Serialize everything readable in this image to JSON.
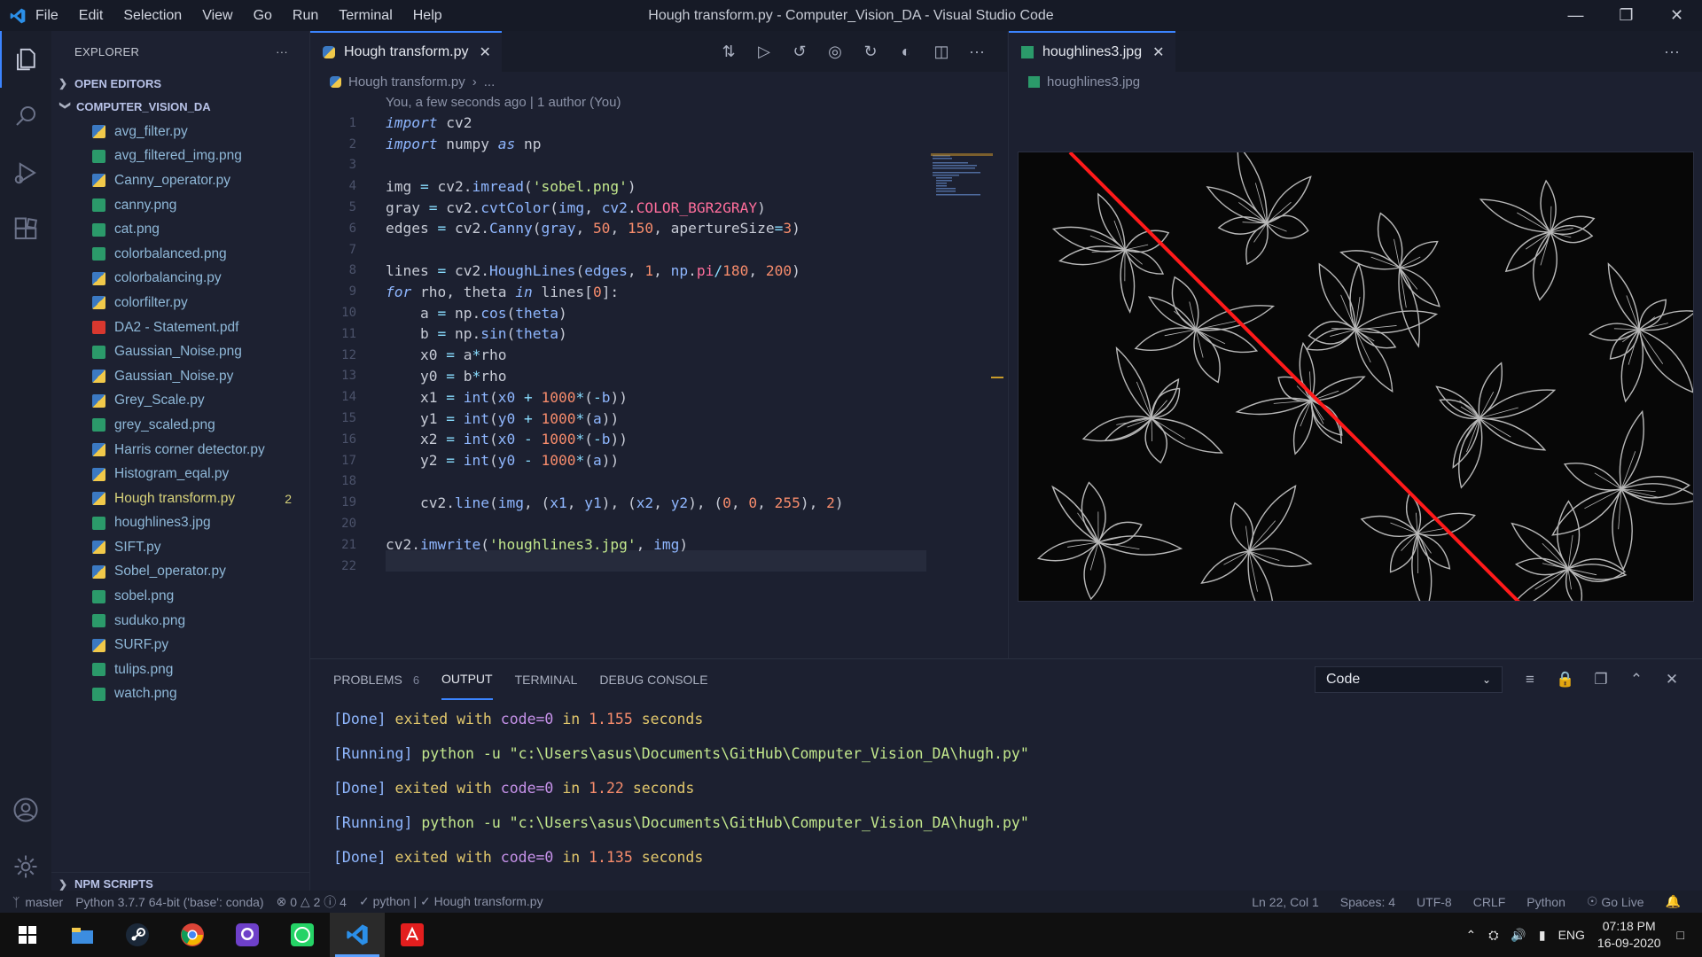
{
  "titlebar": {
    "menu": [
      "File",
      "Edit",
      "Selection",
      "View",
      "Go",
      "Run",
      "Terminal",
      "Help"
    ],
    "title": "Hough transform.py - Computer_Vision_DA - Visual Studio Code"
  },
  "sidebar": {
    "title": "EXPLORER",
    "open_editors": "OPEN EDITORS",
    "folder": "COMPUTER_VISION_DA",
    "npm": "NPM SCRIPTS",
    "files": [
      {
        "name": "avg_filter.py",
        "type": "py"
      },
      {
        "name": "avg_filtered_img.png",
        "type": "img"
      },
      {
        "name": "Canny_operator.py",
        "type": "py"
      },
      {
        "name": "canny.png",
        "type": "img"
      },
      {
        "name": "cat.png",
        "type": "img"
      },
      {
        "name": "colorbalanced.png",
        "type": "img"
      },
      {
        "name": "colorbalancing.py",
        "type": "py"
      },
      {
        "name": "colorfilter.py",
        "type": "py"
      },
      {
        "name": "DA2 - Statement.pdf",
        "type": "pdf"
      },
      {
        "name": "Gaussian_Noise.png",
        "type": "img"
      },
      {
        "name": "Gaussian_Noise.py",
        "type": "py"
      },
      {
        "name": "Grey_Scale.py",
        "type": "py"
      },
      {
        "name": "grey_scaled.png",
        "type": "img"
      },
      {
        "name": "Harris corner detector.py",
        "type": "py"
      },
      {
        "name": "Histogram_eqal.py",
        "type": "py"
      },
      {
        "name": "Hough transform.py",
        "type": "py",
        "active": true,
        "badge": "2"
      },
      {
        "name": "houghlines3.jpg",
        "type": "img"
      },
      {
        "name": "SIFT.py",
        "type": "py"
      },
      {
        "name": "Sobel_operator.py",
        "type": "py"
      },
      {
        "name": "sobel.png",
        "type": "img"
      },
      {
        "name": "suduko.png",
        "type": "img"
      },
      {
        "name": "SURF.py",
        "type": "py"
      },
      {
        "name": "tulips.png",
        "type": "img"
      },
      {
        "name": "watch.png",
        "type": "img"
      }
    ]
  },
  "editor1": {
    "tab": "Hough transform.py",
    "breadcrumb": "Hough transform.py",
    "breadcrumb_more": "...",
    "blame": "You, a few seconds ago | 1 author (You)",
    "line_numbers": [
      "1",
      "2",
      "3",
      "4",
      "5",
      "6",
      "7",
      "8",
      "9",
      "10",
      "11",
      "12",
      "13",
      "14",
      "15",
      "16",
      "17",
      "18",
      "19",
      "20",
      "21",
      "22"
    ]
  },
  "editor2": {
    "tab": "houghlines3.jpg",
    "breadcrumb": "houghlines3.jpg"
  },
  "panel": {
    "tabs": [
      "PROBLEMS",
      "OUTPUT",
      "TERMINAL",
      "DEBUG CONSOLE"
    ],
    "problems_count": "6",
    "select": "Code",
    "output": [
      {
        "kind": "done",
        "code": "code=0",
        "time": "1.155"
      },
      {
        "kind": "run",
        "cmd": "python -u \"c:\\Users\\asus\\Documents\\GitHub\\Computer_Vision_DA\\hugh.py\""
      },
      {
        "kind": "done",
        "code": "code=0",
        "time": "1.22"
      },
      {
        "kind": "run",
        "cmd": "python -u \"c:\\Users\\asus\\Documents\\GitHub\\Computer_Vision_DA\\hugh.py\""
      },
      {
        "kind": "done",
        "code": "code=0",
        "time": "1.135"
      }
    ],
    "done_label": "[Done]",
    "exited": "exited with",
    "in": "in",
    "seconds": "seconds",
    "running_label": "[Running]"
  },
  "statusbar": {
    "branch": "master",
    "interpreter": "Python 3.7.7 64-bit ('base': conda)",
    "errors": "0",
    "warnings": "2",
    "info": "4",
    "linter": "python | ✓ Hough transform.py",
    "position": "Ln 22, Col 1",
    "spaces": "Spaces: 4",
    "encoding": "UTF-8",
    "eol": "CRLF",
    "language": "Python",
    "golive": "Go Live"
  },
  "taskbar": {
    "lang": "ENG",
    "time": "07:18 PM",
    "date": "16-09-2020"
  },
  "colors": {
    "accent": "#3b84ff",
    "hough_line": "#ff1a1a"
  }
}
